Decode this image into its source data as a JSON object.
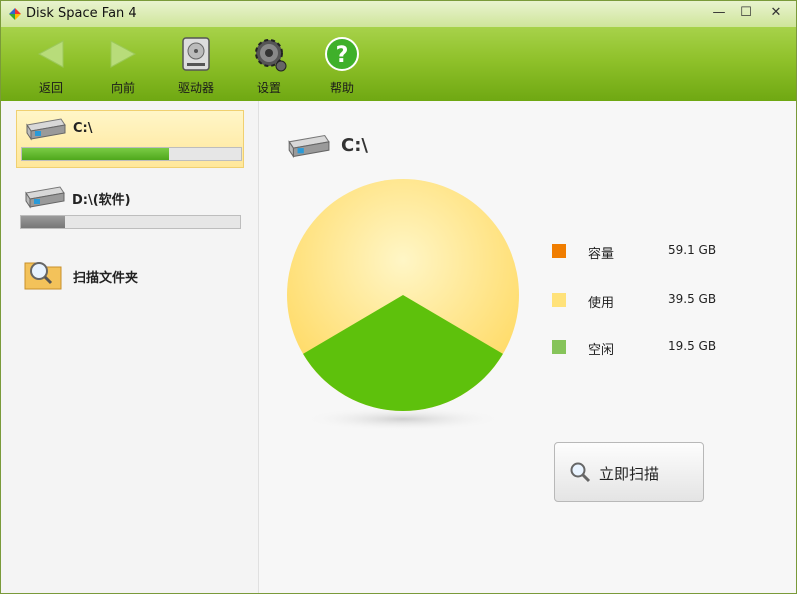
{
  "window": {
    "title": "Disk Space Fan 4"
  },
  "toolbar": {
    "back": "返回",
    "forward": "向前",
    "drives": "驱动器",
    "settings": "设置",
    "help": "帮助"
  },
  "drives": [
    {
      "name": "C:\\",
      "usage_fraction": 0.67
    },
    {
      "name": "D:\\(软件)",
      "usage_fraction": 0.2
    }
  ],
  "scan_folder": "扫描文件夹",
  "detail": {
    "drive_name": "C:\\",
    "legend": [
      {
        "label": "容量",
        "value": "59.1 GB",
        "color": "#f07d00"
      },
      {
        "label": "使用",
        "value": "39.5 GB",
        "color": "#ffe27a"
      },
      {
        "label": "空闲",
        "value": "19.5 GB",
        "color": "#86c45a"
      }
    ],
    "pie": {
      "used_gb": 39.5,
      "free_gb": 19.5,
      "used_color": "#ffe27a",
      "free_color": "#5ec10c"
    }
  },
  "scan_now": "立即扫描"
}
